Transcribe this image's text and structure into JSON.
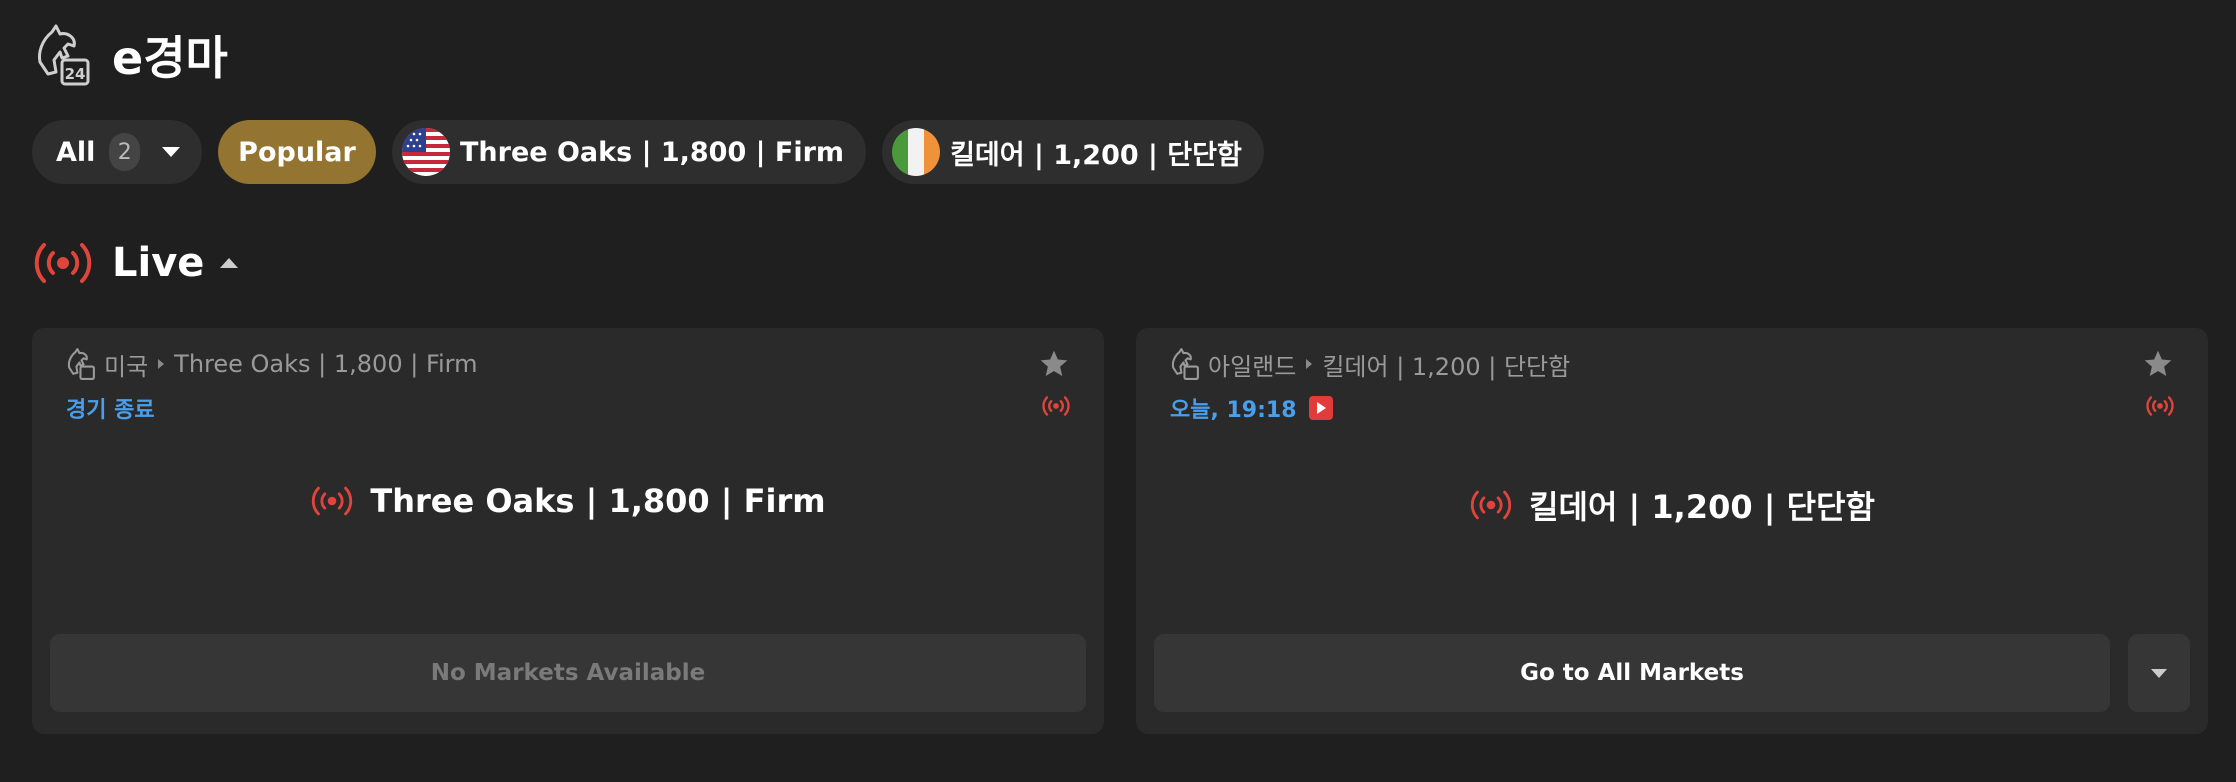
{
  "header": {
    "title": "e경마",
    "logo_icon": "horse-24-logo-icon"
  },
  "filters": {
    "all_label": "All",
    "all_count": "2",
    "popular_label": "Popular",
    "chips": [
      {
        "label": "Three Oaks | 1,800 | Firm",
        "flag": "us-flag-icon"
      },
      {
        "label": "킬데어 | 1,200 | 단단함",
        "flag": "ireland-flag-icon"
      }
    ]
  },
  "live": {
    "title": "Live",
    "icon": "live-broadcast-icon"
  },
  "events": [
    {
      "country": "미국",
      "track": "Three Oaks | 1,800 | Firm",
      "status": "경기 종료",
      "name": "Three Oaks | 1,800 | Firm",
      "button": "No Markets Available",
      "button_enabled": false
    },
    {
      "country": "아일랜드",
      "track": "킬데어 | 1,200 | 단단함",
      "status": "오늘, 19:18",
      "has_video": true,
      "name": "킬데어 | 1,200 | 단단함",
      "button": "Go to All Markets",
      "button_enabled": true
    }
  ],
  "colors": {
    "background": "#1f1f1f",
    "card": "#2a2a2a",
    "chip": "#2e2e2e",
    "popular": "#937431",
    "live_red": "#e0443b",
    "status_blue": "#4a9eea"
  }
}
